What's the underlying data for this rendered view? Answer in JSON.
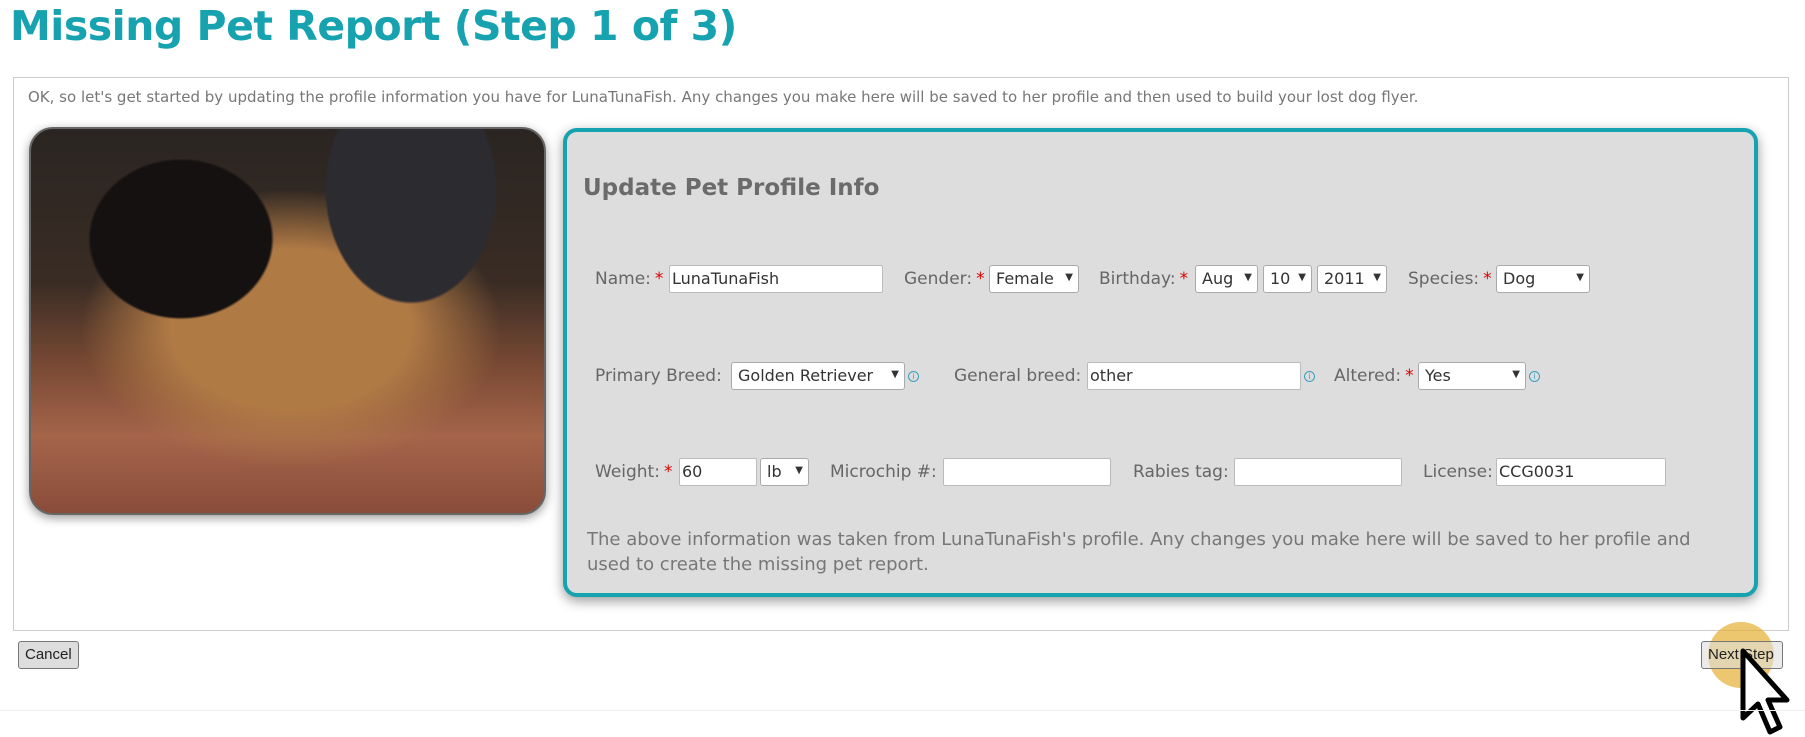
{
  "page_title": "Missing Pet Report (Step 1 of 3)",
  "intro": "OK, so let's get started by updating the profile information you have for LunaTunaFish. Any changes you make here will be saved to her profile and then used to build your lost dog flyer.",
  "form": {
    "heading": "Update Pet Profile Info",
    "name": {
      "label": "Name:",
      "value": "LunaTunaFish"
    },
    "gender": {
      "label": "Gender:",
      "value": "Female"
    },
    "birthday": {
      "label": "Birthday:",
      "month": "Aug",
      "day": "10",
      "year": "2011"
    },
    "species": {
      "label": "Species:",
      "value": "Dog"
    },
    "primary_breed": {
      "label": "Primary Breed:",
      "value": "Golden Retriever"
    },
    "general_breed": {
      "label": "General breed:",
      "value": "other"
    },
    "altered": {
      "label": "Altered:",
      "value": "Yes"
    },
    "weight": {
      "label": "Weight:",
      "value": "60",
      "unit": "lb"
    },
    "microchip": {
      "label": "Microchip #:",
      "value": ""
    },
    "rabies": {
      "label": "Rabies tag:",
      "value": ""
    },
    "license": {
      "label": "License:",
      "value": "CCG0031"
    },
    "required_mark": "*",
    "note": "The above information was taken from LunaTunaFish's profile. Any changes you make here will be saved to her profile and used to create the missing pet report."
  },
  "buttons": {
    "cancel": "Cancel",
    "next": "Next Step"
  },
  "colors": {
    "accent": "#17a2b0",
    "required": "#dd0000"
  }
}
